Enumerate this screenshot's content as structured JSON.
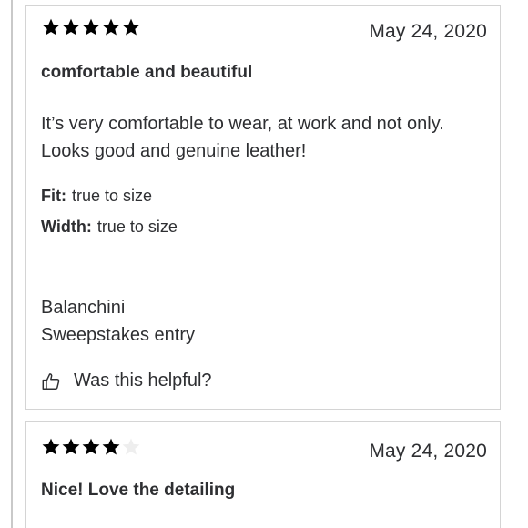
{
  "reviews": [
    {
      "rating": 5,
      "max_rating": 5,
      "date": "May 24, 2020",
      "title": "comfortable and beautiful",
      "body_line1": "It’s very comfortable to wear, at work and not only.",
      "body_line2": "Looks good and genuine leather!",
      "fit_label": "Fit:",
      "fit_value": "true to size",
      "width_label": "Width:",
      "width_value": "true to size",
      "author": "Balanchini",
      "badge": "Sweepstakes entry",
      "helpful_label": "Was this helpful?"
    },
    {
      "rating": 4,
      "max_rating": 5,
      "date": "May 24, 2020",
      "title": "Nice! Love the detailing"
    }
  ],
  "colors": {
    "star_filled": "#000000",
    "star_empty": "#eeeeee",
    "card_border": "#d4d4d4",
    "text": "#2e2f32"
  },
  "icons": {
    "star": "star-icon",
    "thumbs_up": "thumbs-up-icon"
  }
}
